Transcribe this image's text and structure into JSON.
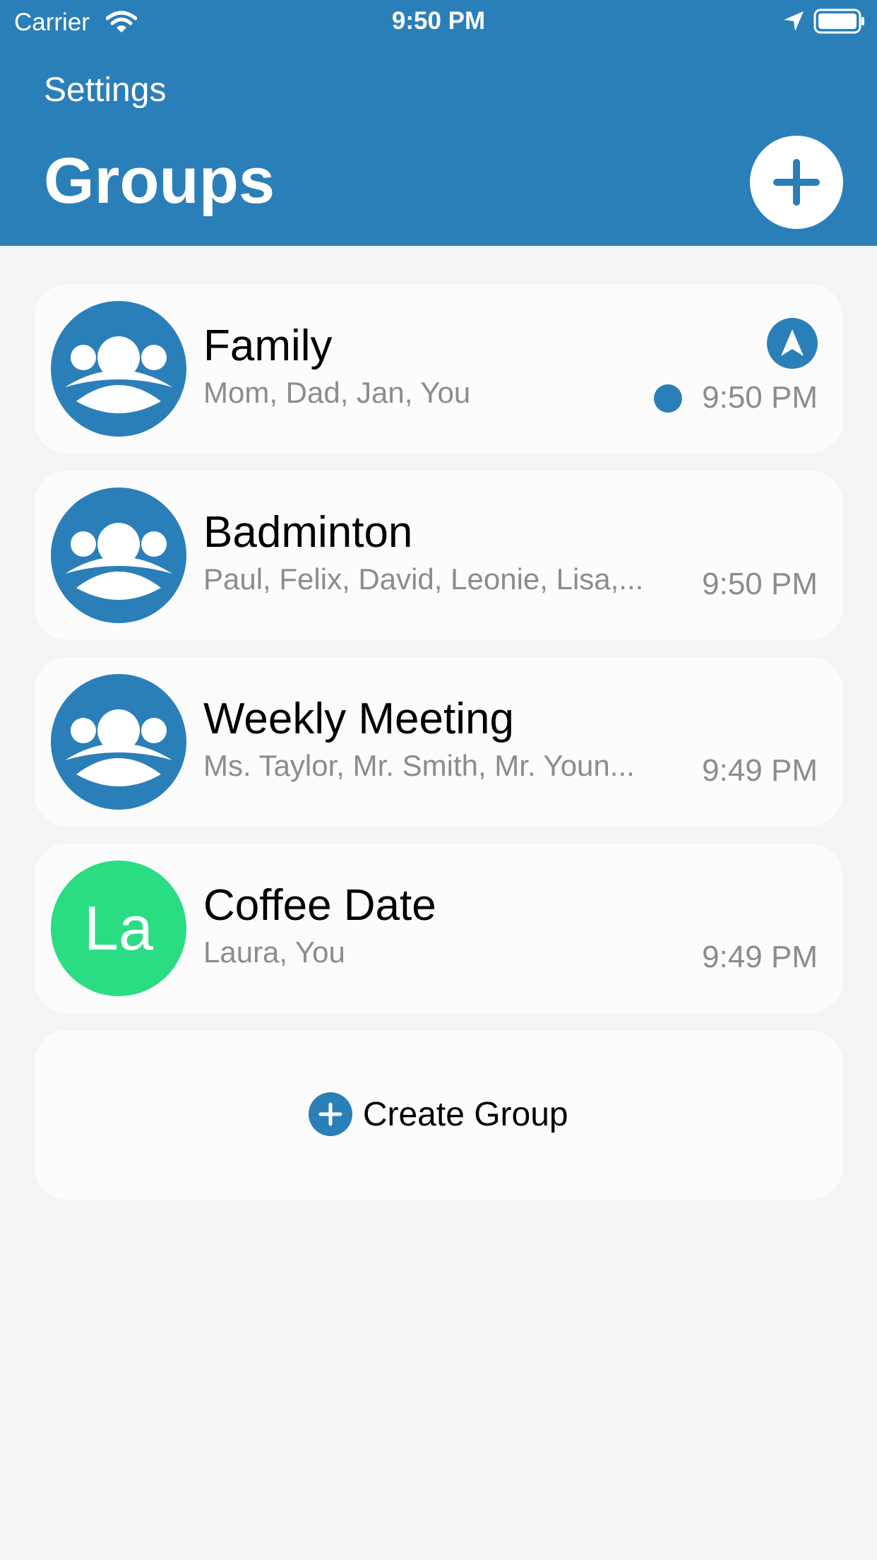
{
  "status_bar": {
    "carrier": "Carrier",
    "time": "9:50 PM"
  },
  "header": {
    "back_label": "Settings",
    "title": "Groups"
  },
  "groups": [
    {
      "name": "Family",
      "members": "Mom, Dad, Jan, You",
      "time": "9:50 PM",
      "avatar_icon": "group-icon",
      "unread": true,
      "navigation_active": true
    },
    {
      "name": "Badminton",
      "members": "Paul, Felix, David, Leonie, Lisa,...",
      "time": "9:50 PM",
      "avatar_icon": "group-icon"
    },
    {
      "name": "Weekly Meeting",
      "members": "Ms. Taylor, Mr. Smith, Mr. Youn...",
      "time": "9:49 PM",
      "avatar_icon": "group-icon"
    },
    {
      "name": "Coffee Date",
      "members": "Laura, You",
      "time": "9:49 PM",
      "avatar_initials": "La",
      "avatar_color": "#2add83"
    }
  ],
  "create_group": {
    "label": "Create Group"
  },
  "colors": {
    "accent": "#2b7fb8",
    "background": "#f3f4f6",
    "card": "#fcfcfd",
    "secondary_text": "#8b8b90"
  }
}
